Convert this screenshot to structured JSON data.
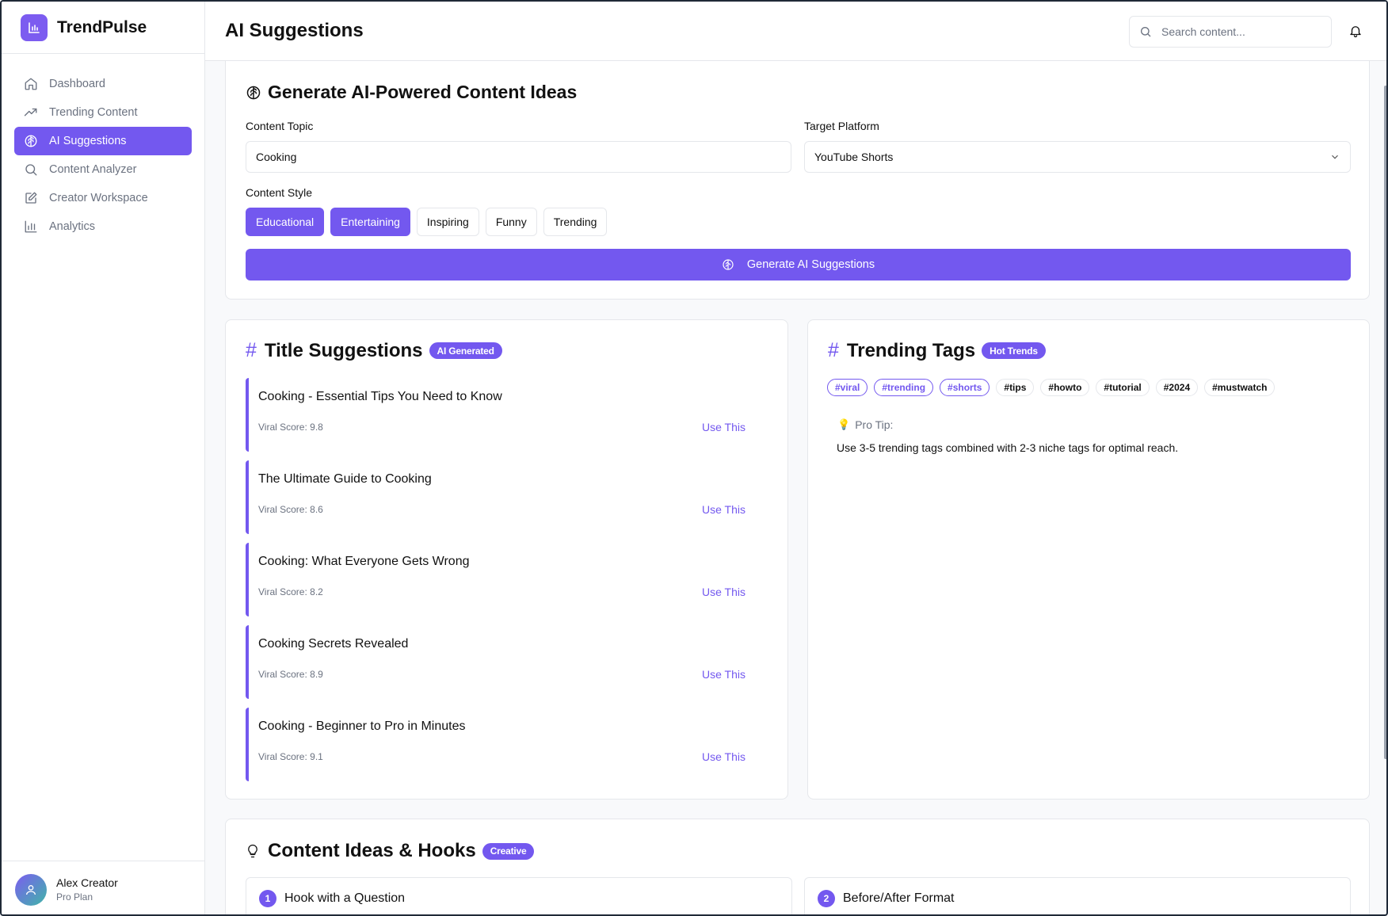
{
  "brand": {
    "name": "TrendPulse"
  },
  "sidebar": {
    "items": [
      {
        "label": "Dashboard",
        "icon": "home-icon"
      },
      {
        "label": "Trending Content",
        "icon": "trending-up-icon"
      },
      {
        "label": "AI Suggestions",
        "icon": "brain-icon",
        "active": true
      },
      {
        "label": "Content Analyzer",
        "icon": "search-icon"
      },
      {
        "label": "Creator Workspace",
        "icon": "edit-icon"
      },
      {
        "label": "Analytics",
        "icon": "bar-chart-icon"
      }
    ],
    "user": {
      "name": "Alex Creator",
      "plan": "Pro Plan"
    }
  },
  "header": {
    "title": "AI Suggestions",
    "search_placeholder": "Search content..."
  },
  "generator": {
    "title": "Generate AI-Powered Content Ideas",
    "topic_label": "Content Topic",
    "topic_value": "Cooking",
    "platform_label": "Target Platform",
    "platform_value": "YouTube Shorts",
    "style_label": "Content Style",
    "styles": [
      {
        "label": "Educational",
        "selected": true
      },
      {
        "label": "Entertaining",
        "selected": true
      },
      {
        "label": "Inspiring",
        "selected": false
      },
      {
        "label": "Funny",
        "selected": false
      },
      {
        "label": "Trending",
        "selected": false
      }
    ],
    "button_label": "Generate AI Suggestions"
  },
  "titles": {
    "heading": "Title Suggestions",
    "badge": "AI Generated",
    "items": [
      {
        "title": "Cooking - Essential Tips You Need to Know",
        "score": "Viral Score: 9.8",
        "action": "Use This"
      },
      {
        "title": "The Ultimate Guide to Cooking",
        "score": "Viral Score: 8.6",
        "action": "Use This"
      },
      {
        "title": "Cooking: What Everyone Gets Wrong",
        "score": "Viral Score: 8.2",
        "action": "Use This"
      },
      {
        "title": "Cooking Secrets Revealed",
        "score": "Viral Score: 8.9",
        "action": "Use This"
      },
      {
        "title": "Cooking - Beginner to Pro in Minutes",
        "score": "Viral Score: 9.1",
        "action": "Use This"
      }
    ]
  },
  "tags": {
    "heading": "Trending Tags",
    "badge": "Hot Trends",
    "items": [
      {
        "label": "#viral",
        "hot": true
      },
      {
        "label": "#trending",
        "hot": true
      },
      {
        "label": "#shorts",
        "hot": true
      },
      {
        "label": "#tips",
        "hot": false
      },
      {
        "label": "#howto",
        "hot": false
      },
      {
        "label": "#tutorial",
        "hot": false
      },
      {
        "label": "#2024",
        "hot": false
      },
      {
        "label": "#mustwatch",
        "hot": false
      }
    ],
    "protip_label": "Pro Tip:",
    "protip_text": "Use 3-5 trending tags combined with 2-3 niche tags for optimal reach."
  },
  "ideas": {
    "heading": "Content Ideas & Hooks",
    "badge": "Creative",
    "items": [
      {
        "num": "1",
        "title": "Hook with a Question"
      },
      {
        "num": "2",
        "title": "Before/After Format"
      }
    ]
  },
  "colors": {
    "accent": "#7358ef",
    "border": "#e5e7eb",
    "muted": "#6b7280"
  }
}
